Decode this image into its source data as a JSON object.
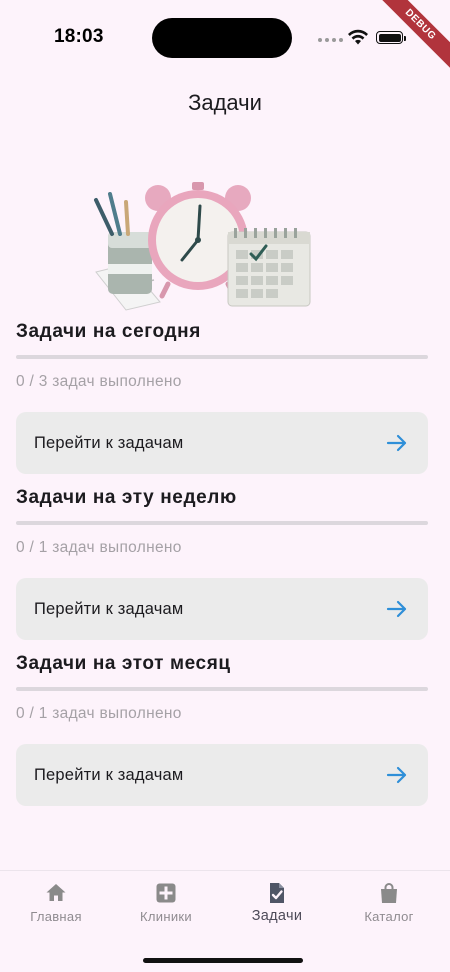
{
  "status_bar": {
    "time": "18:03",
    "debug_label": "DEBUG"
  },
  "app_bar": {
    "title": "Задачи"
  },
  "illustration": {
    "icon": "alarm-clock-calendar-pencils-illustration"
  },
  "sections": [
    {
      "title": "Задачи на сегодня",
      "progress_text": "0 / 3 задач выполнено",
      "progress": 0,
      "button_label": "Перейти к задачам"
    },
    {
      "title": "Задачи на эту неделю",
      "progress_text": "0 / 1 задач выполнено",
      "progress": 0,
      "button_label": "Перейти к задачам"
    },
    {
      "title": "Задачи на этот месяц",
      "progress_text": "0 / 1 задач выполнено",
      "progress": 0,
      "button_label": "Перейти к задачам"
    }
  ],
  "bottom_nav": {
    "items": [
      {
        "label": "Главная",
        "icon": "home-icon",
        "active": false
      },
      {
        "label": "Клиники",
        "icon": "clinic-plus-icon",
        "active": false
      },
      {
        "label": "Задачи",
        "icon": "task-check-icon",
        "active": true
      },
      {
        "label": "Каталог",
        "icon": "shopping-bag-icon",
        "active": false
      }
    ]
  },
  "colors": {
    "background": "#fdf3fb",
    "card": "#ebebeb",
    "arrow": "#2f8fd8",
    "progress_track": "#dcd7dd",
    "debug_ribbon": "#b1343c"
  }
}
